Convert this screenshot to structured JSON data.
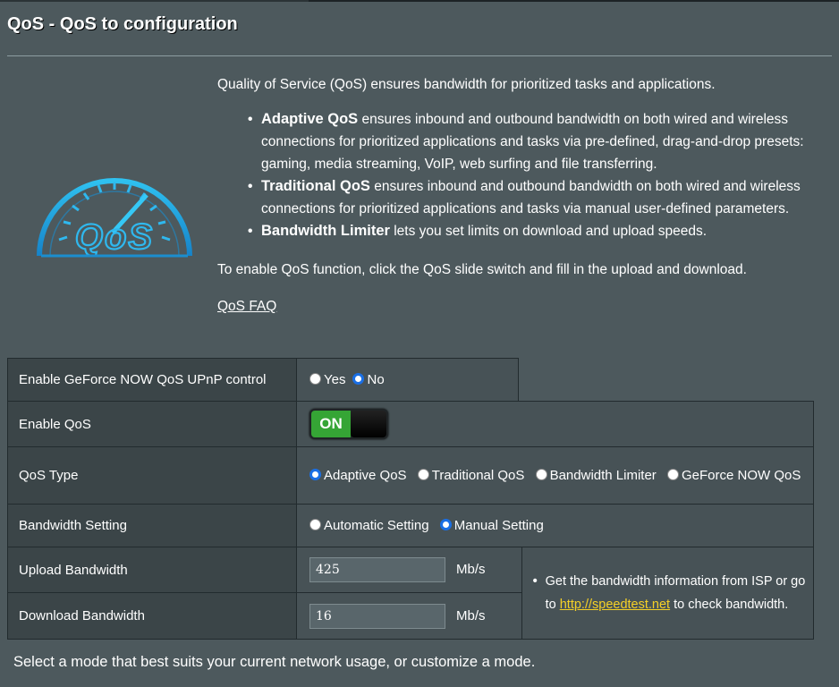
{
  "page": {
    "title": "QoS - QoS to configuration",
    "logo_text": "QoS"
  },
  "description": {
    "intro": "Quality of Service (QoS) ensures bandwidth for prioritized tasks and applications.",
    "bullets": [
      {
        "bold": "Adaptive QoS",
        "text": " ensures inbound and outbound bandwidth on both wired and wireless connections for prioritized applications and tasks via pre-defined, drag-and-drop presets: gaming, media streaming, VoIP, web surfing and file transferring."
      },
      {
        "bold": "Traditional QoS",
        "text": " ensures inbound and outbound bandwidth on both wired and wireless connections for prioritized applications and tasks via manual user-defined parameters."
      },
      {
        "bold": "Bandwidth Limiter",
        "text": " lets you set limits on download and upload speeds."
      }
    ],
    "enable_text": "To enable QoS function, click the QoS slide switch and fill in the upload and download.",
    "faq_link": "QoS FAQ"
  },
  "settings": {
    "geforce_upnp": {
      "label": "Enable GeForce NOW QoS UPnP control",
      "options": [
        "Yes",
        "No"
      ],
      "selected": "No"
    },
    "enable_qos": {
      "label": "Enable QoS",
      "state": "ON"
    },
    "qos_type": {
      "label": "QoS Type",
      "options": [
        "Adaptive QoS",
        "Traditional QoS",
        "Bandwidth Limiter",
        "GeForce NOW QoS"
      ],
      "selected": "Adaptive QoS"
    },
    "bandwidth_setting": {
      "label": "Bandwidth Setting",
      "options": [
        "Automatic Setting",
        "Manual Setting"
      ],
      "selected": "Manual Setting"
    },
    "upload": {
      "label": "Upload Bandwidth",
      "value": "425",
      "unit": "Mb/s"
    },
    "download": {
      "label": "Download Bandwidth",
      "value": "16",
      "unit": "Mb/s"
    },
    "note": {
      "prefix": "Get the bandwidth information from ISP or go to ",
      "link": "http://speedtest.net",
      "suffix": " to check bandwidth."
    }
  },
  "footer": {
    "text": "Select a mode that best suits your current network usage, or customize a mode."
  },
  "colors": {
    "background": "#4d595d",
    "toggle_on": "#35a535",
    "link": "#f5d026",
    "radio_selected": "#1a6fe5"
  }
}
